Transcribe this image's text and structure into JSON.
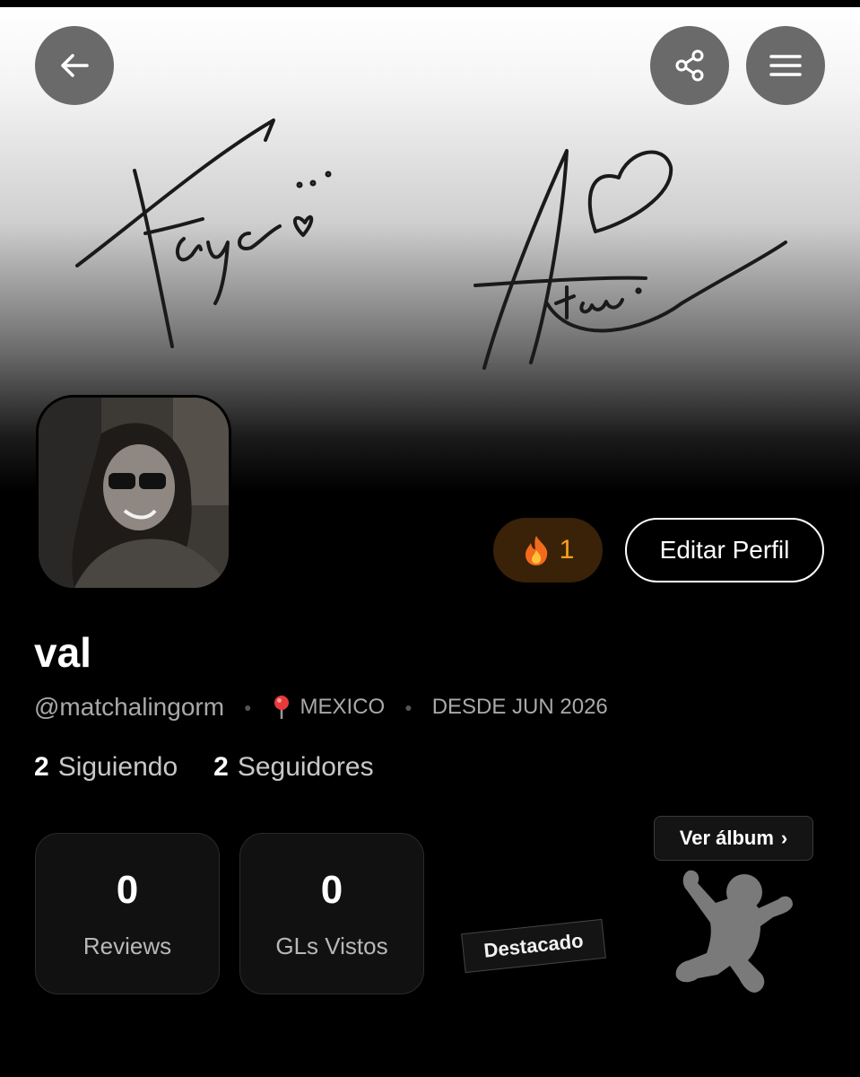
{
  "profile": {
    "display_name": "val",
    "handle": "@matchalingorm",
    "location": "MEXICO",
    "since": "DESDE JUN 2026",
    "streak_count": "1",
    "edit_label": "Editar Perfil"
  },
  "follow": {
    "following_count": "2",
    "following_label": "Siguiendo",
    "followers_count": "2",
    "followers_label": "Seguidores"
  },
  "stats": [
    {
      "value": "0",
      "label": "Reviews"
    },
    {
      "value": "0",
      "label": "GLs Vistos"
    }
  ],
  "featured": {
    "tag_label": "Destacado",
    "album_label": "Ver álbum",
    "album_chevron": "›"
  },
  "icons": {
    "back": "back-arrow-icon",
    "share": "share-icon",
    "menu": "hamburger-menu-icon",
    "streak": "fire-icon",
    "location": "pin-icon"
  },
  "colors": {
    "background": "#000000",
    "streak_accent": "#f7a21b",
    "streak_bg": "#3a2208",
    "button_gray": "#6a6a6a"
  }
}
